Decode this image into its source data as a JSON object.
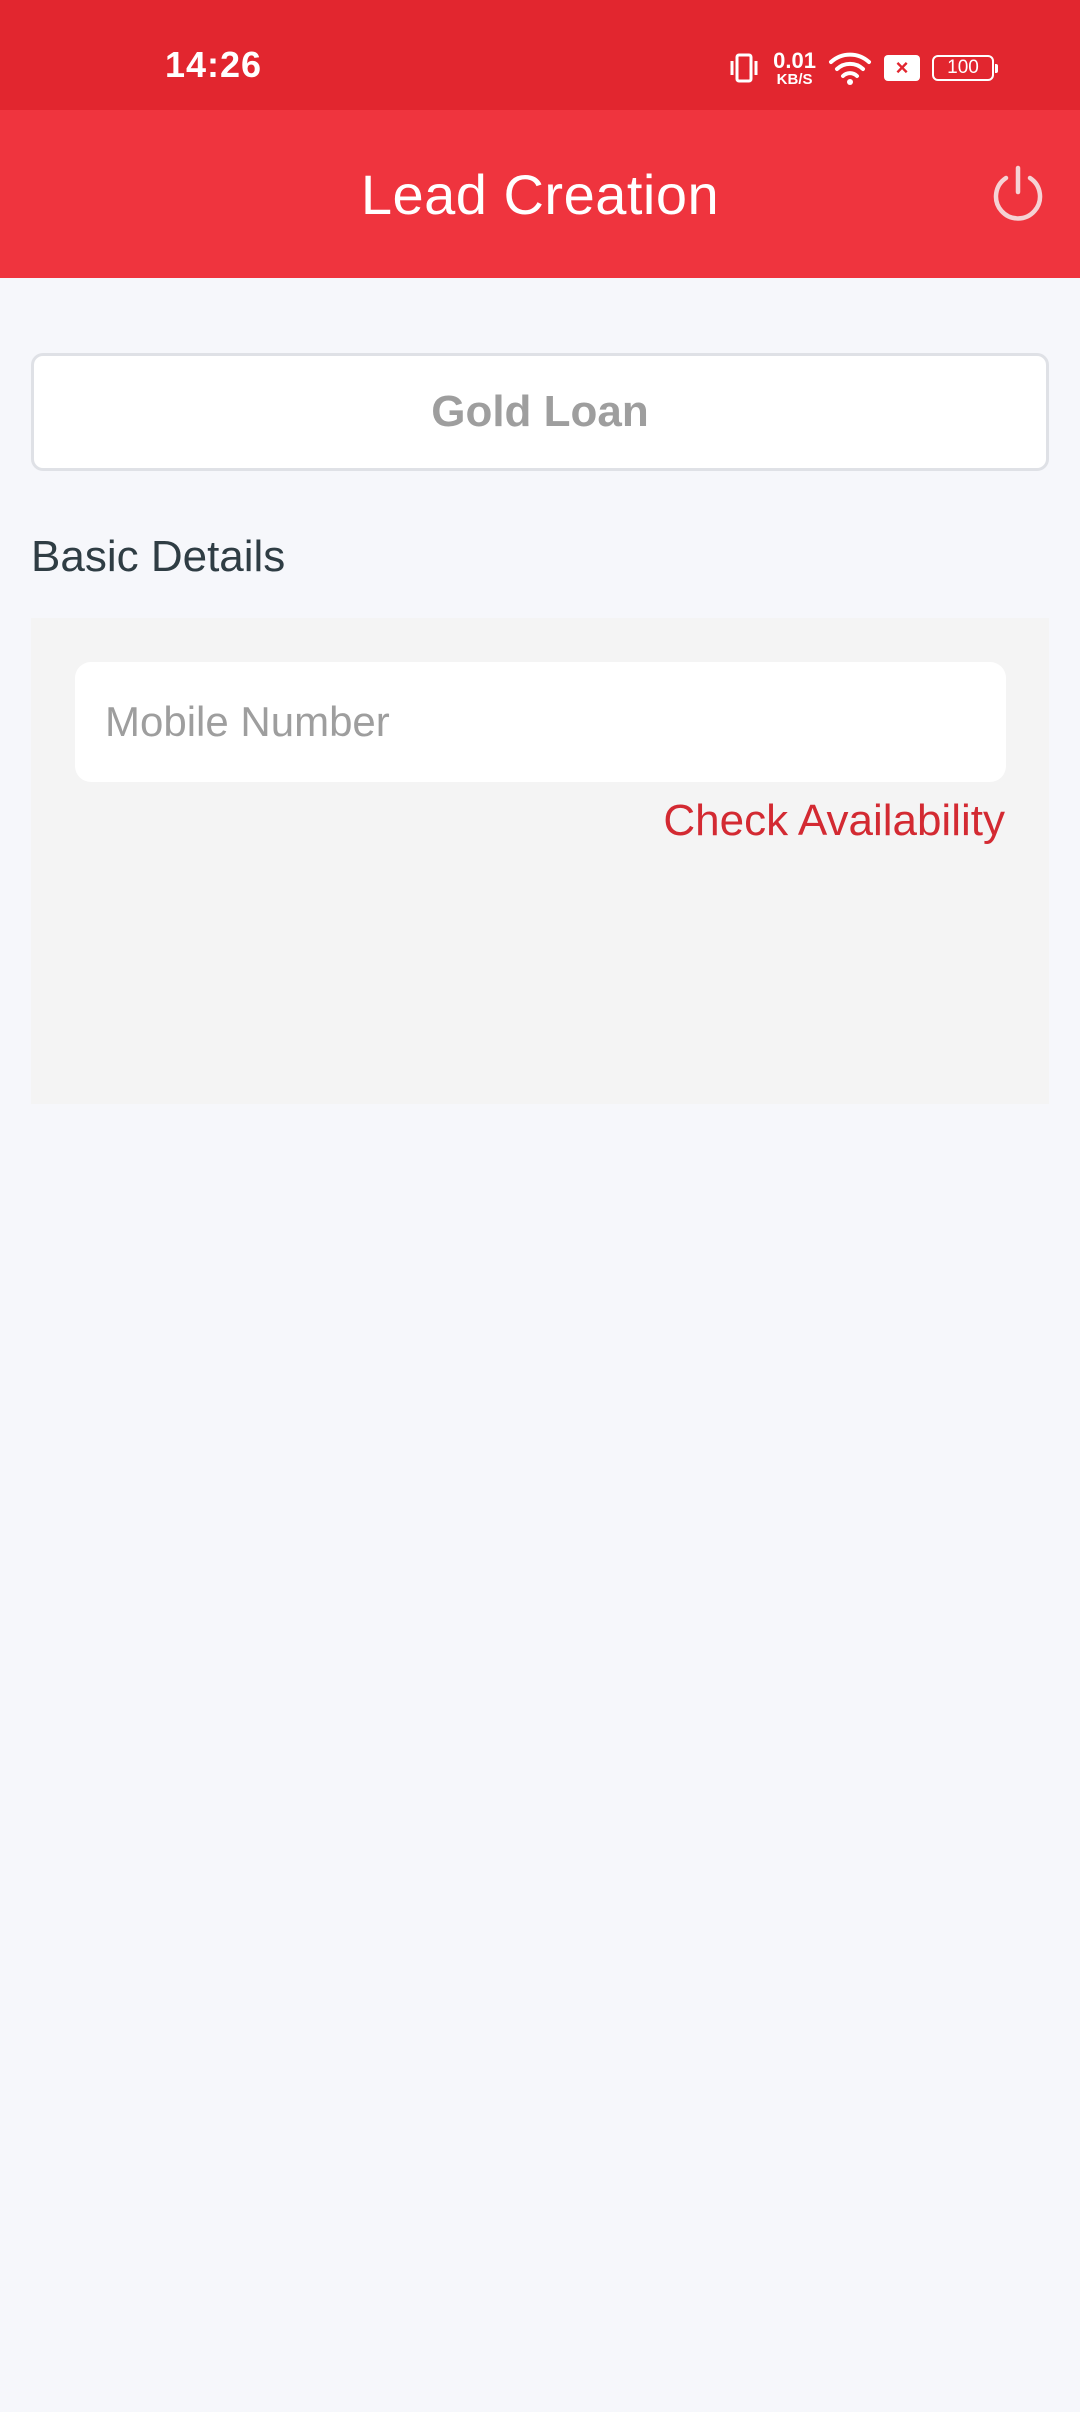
{
  "status_bar": {
    "time": "14:26",
    "net_speed_value": "0.01",
    "net_speed_unit": "KB/S",
    "sim_badge": "×",
    "battery": "100",
    "icons": [
      "vibrate-icon",
      "wifi-icon",
      "sim-disabled-icon",
      "battery-icon"
    ]
  },
  "header": {
    "title": "Lead Creation",
    "power_icon": "power-icon"
  },
  "product": {
    "selected": "Gold Loan"
  },
  "basic_details": {
    "title": "Basic Details",
    "mobile_placeholder": "Mobile Number",
    "mobile_value": "",
    "check_label": "Check Availability"
  },
  "colors": {
    "status_bar": "#e2262f",
    "app_bar": "#ef343e",
    "accent_text": "#d32a32",
    "background": "#f6f7fb"
  }
}
